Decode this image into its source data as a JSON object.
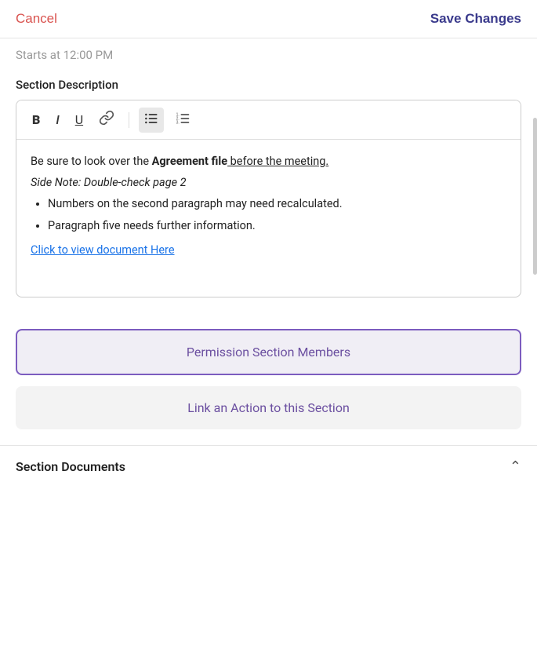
{
  "header": {
    "cancel_label": "Cancel",
    "save_label": "Save Changes"
  },
  "subheader": {
    "time_label": "Starts at 12:00 PM"
  },
  "section_description": {
    "label": "Section Description",
    "toolbar": {
      "bold_label": "B",
      "italic_label": "I",
      "underline_label": "U",
      "link_icon": "🔗",
      "bullet_list_icon": "≡",
      "numbered_list_icon": "≡"
    },
    "content": {
      "line1_normal": "Be sure to look over the ",
      "line1_bold": "Agreement file",
      "line1_underline_link": " before the meeting.",
      "line2_italic": "Side Note: Double-check page 2",
      "bullet1": "Numbers on the second paragraph may need recalculated.",
      "bullet2": "Paragraph five needs further information.",
      "doc_link": "Click to view document Here"
    }
  },
  "buttons": {
    "permission_label": "Permission Section Members",
    "link_action_label": "Link an Action to this Section"
  },
  "section_documents": {
    "title": "Section Documents"
  }
}
